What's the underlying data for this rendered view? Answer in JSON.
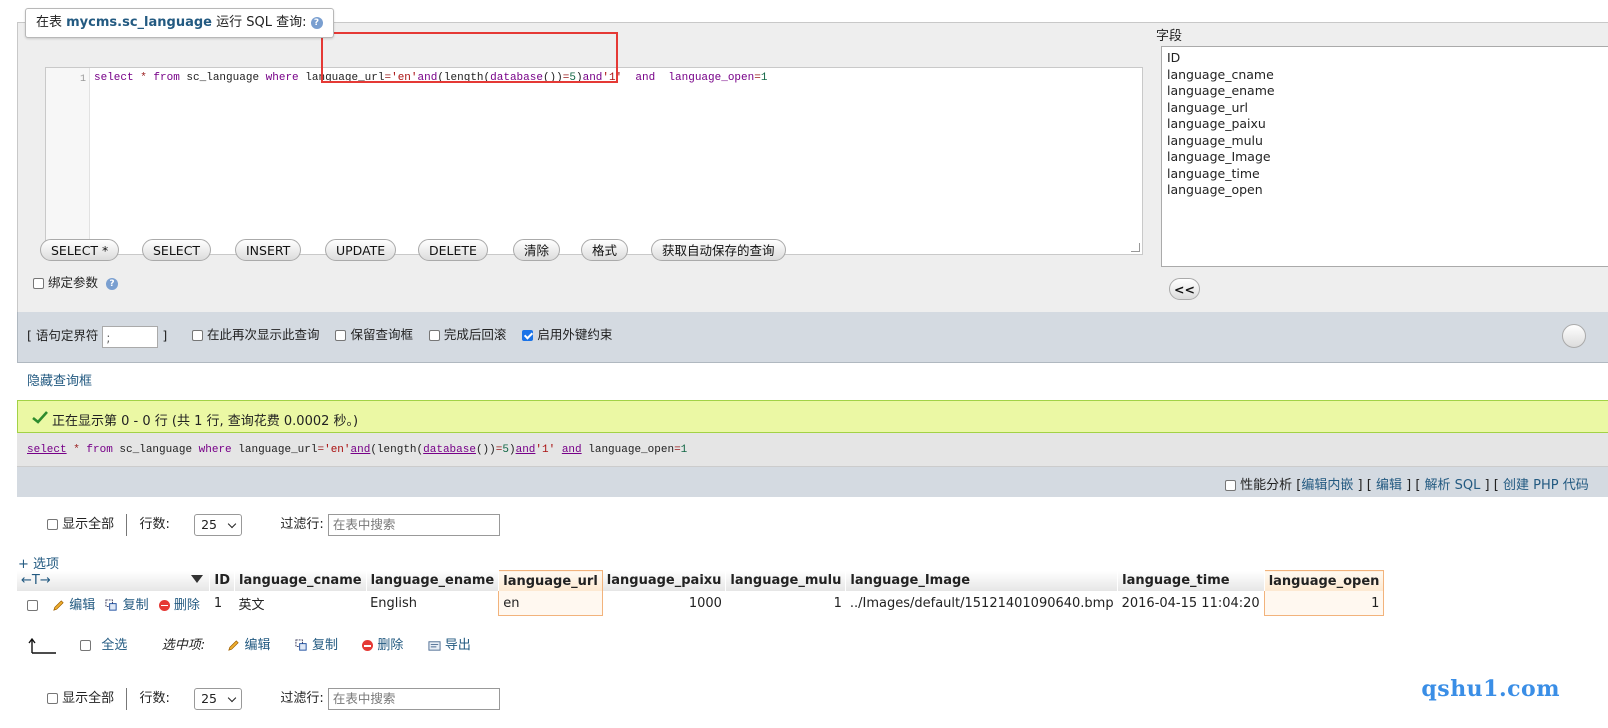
{
  "query_panel": {
    "legend_prefix": "在表 ",
    "legend_table": "mycms.sc_language",
    "legend_suffix": " 运行 SQL 查询:",
    "line_number": "1",
    "sql": {
      "p1": "select",
      "p2": " * ",
      "p3": "from",
      "p4": " sc_language ",
      "p5": "where",
      "p6": " language_url",
      "p7": "=",
      "p8": "'en'",
      "p9": "and",
      "p10": "(length(",
      "p11": "database",
      "p12": "())",
      "p13": "=",
      "p14": "5",
      "p15": ")",
      "p16": "and",
      "p17": "'1'",
      "p18": "  and  language_open",
      "p19": "=",
      "p20": "1"
    },
    "buttons": [
      "SELECT *",
      "SELECT",
      "INSERT",
      "UPDATE",
      "DELETE",
      "清除",
      "格式",
      "获取自动保存的查询"
    ],
    "bind_params_label": "绑定参数",
    "fields_label": "字段",
    "fields": [
      "ID",
      "language_cname",
      "language_ename",
      "language_url",
      "language_paixu",
      "language_mulu",
      "language_Image",
      "language_time",
      "language_open"
    ],
    "insert_field_button": "<<"
  },
  "options": {
    "delimiter_label_open": "[ 语句定界符",
    "delimiter_value": ";",
    "delimiter_label_close": "]",
    "show_again_label": "在此再次显示此查询",
    "keep_box_label": "保留查询框",
    "rollback_label": "完成后回滚",
    "fk_label": "启用外键约束",
    "fk_checked": true
  },
  "hide_query_link": "隐藏查询框",
  "success_message": "正在显示第 0 - 0 行 (共 1 行, 查询花费 0.0002 秒。)",
  "echo_sql": {
    "e1": "select",
    "e2": " * ",
    "e3": "from",
    "e4": " sc_language ",
    "e5": "where",
    "e6": " language_url",
    "e7": "=",
    "e8": "'en'",
    "e9": "and",
    "e10": "(length(",
    "e11": "database",
    "e12": "())",
    "e13": "=",
    "e14": "5",
    "e15": ")",
    "e16": "and",
    "e17": "'1'",
    "e18": " ",
    "e19": "and",
    "e20": " language_open",
    "e21": "=",
    "e22": "1"
  },
  "echo_tools": {
    "profiling": "性能分析",
    "open_bracket": "[",
    "edit_inline": "编辑内嵌",
    "sep": "] [",
    "edit": "编辑",
    "explain": "解析 SQL",
    "php_code": "创建 PHP 代码"
  },
  "nav": {
    "show_all": "显示全部",
    "rows_label": "行数:",
    "rows_value": "25",
    "filter_label": "过滤行:",
    "filter_placeholder": "在表中搜索"
  },
  "options_link": "+ 选项",
  "table": {
    "arrows": "←T→",
    "columns": [
      "ID",
      "language_cname",
      "language_ename",
      "language_url",
      "language_paixu",
      "language_mulu",
      "language_Image",
      "language_time",
      "language_open"
    ],
    "row_actions": {
      "edit": "编辑",
      "copy": "复制",
      "delete": "删除"
    },
    "rows": [
      {
        "ID": "1",
        "language_cname": "英文",
        "language_ename": "English",
        "language_url": "en",
        "language_paixu": "1000",
        "language_mulu": "1",
        "language_Image": "../Images/default/15121401090640.bmp",
        "language_time": "2016-04-15 11:04:20",
        "language_open": "1"
      }
    ]
  },
  "bulk": {
    "select_all": "全选",
    "with_selected": "选中项:",
    "edit": "编辑",
    "copy": "复制",
    "delete": "删除",
    "export": "导出"
  },
  "watermark": "qshu1.com",
  "colors": {
    "accent": "#235a81",
    "success_bg": "#ebf8a4",
    "highlight_red": "#e53935"
  }
}
